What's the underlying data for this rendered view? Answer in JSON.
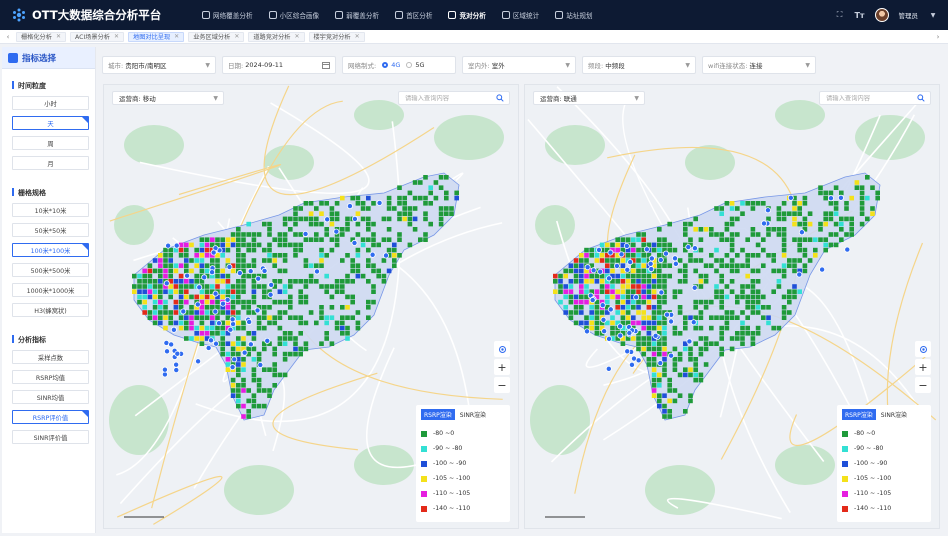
{
  "app": {
    "title": "OTT大数据综合分析平台"
  },
  "nav": [
    {
      "label": "网络覆盖分析"
    },
    {
      "label": "小区综合画像"
    },
    {
      "label": "弱覆盖分析"
    },
    {
      "label": "首区分析"
    },
    {
      "label": "竞对分析"
    },
    {
      "label": "区域统计"
    },
    {
      "label": "站址规划"
    }
  ],
  "nav_active": "竞对分析",
  "user": {
    "name": "管理员"
  },
  "tabs": [
    {
      "label": "栅格化分析"
    },
    {
      "label": "ACI场景分析"
    },
    {
      "label": "地图对比呈现"
    },
    {
      "label": "业务区域分析"
    },
    {
      "label": "道路竞对分析"
    },
    {
      "label": "楼宇竞对分析"
    }
  ],
  "active_tab": "地图对比呈现",
  "sidebar": {
    "title": "指标选择",
    "time_title": "时间粒度",
    "time_options": [
      "小时",
      "天",
      "周",
      "月"
    ],
    "time_selected": "天",
    "grid_title": "栅格规格",
    "grid_options": [
      "10米*10米",
      "50米*50米",
      "100米*100米",
      "500米*500米",
      "1000米*1000米",
      "H3(蜂窝状)"
    ],
    "grid_selected": "100米*100米",
    "metric_title": "分析指标",
    "metric_options": [
      "采样点数",
      "RSRP均值",
      "SINR均值",
      "RSRP评价值",
      "SINR评价值"
    ],
    "metric_selected": "RSRP评价值"
  },
  "filters": {
    "city_label": "城市:",
    "city_value": "贵阳市/南明区",
    "date_label": "日期:",
    "date_value": "2024-09-11",
    "net_label": "网络制式:",
    "net_options": [
      "4G",
      "5G"
    ],
    "net_selected": "4G",
    "indoor_label": "室内外:",
    "indoor_value": "室外",
    "band_label": "频段:",
    "band_value": "中频段",
    "wifi_label": "wifi连接状态:",
    "wifi_value": "连接"
  },
  "maps": [
    {
      "operator_label": "运营商:",
      "operator_value": "移动",
      "search_placeholder": "请输入查询内容"
    },
    {
      "operator_label": "运营商:",
      "operator_value": "联通",
      "search_placeholder": "请输入查询内容"
    }
  ],
  "legend": {
    "tabs": [
      "RSRP渲染",
      "SINR渲染"
    ],
    "active": "RSRP渲染",
    "items": [
      {
        "label": "-80 ~0",
        "color": "#1f9a3a"
      },
      {
        "label": "-90 ~ -80",
        "color": "#33e0d4"
      },
      {
        "label": "-100 ~ -90",
        "color": "#1f4fd8"
      },
      {
        "label": "-105 ~ -100",
        "color": "#f4e11b"
      },
      {
        "label": "-110 ~ -105",
        "color": "#e61ee0"
      },
      {
        "label": "-140 ~ -110",
        "color": "#e32a1a"
      }
    ]
  },
  "colors": {
    "brand": "#2f6bf0",
    "topbar": "#0d1a33",
    "region_fill": "#cfdaf2",
    "green_area": "#bfe3c6"
  }
}
